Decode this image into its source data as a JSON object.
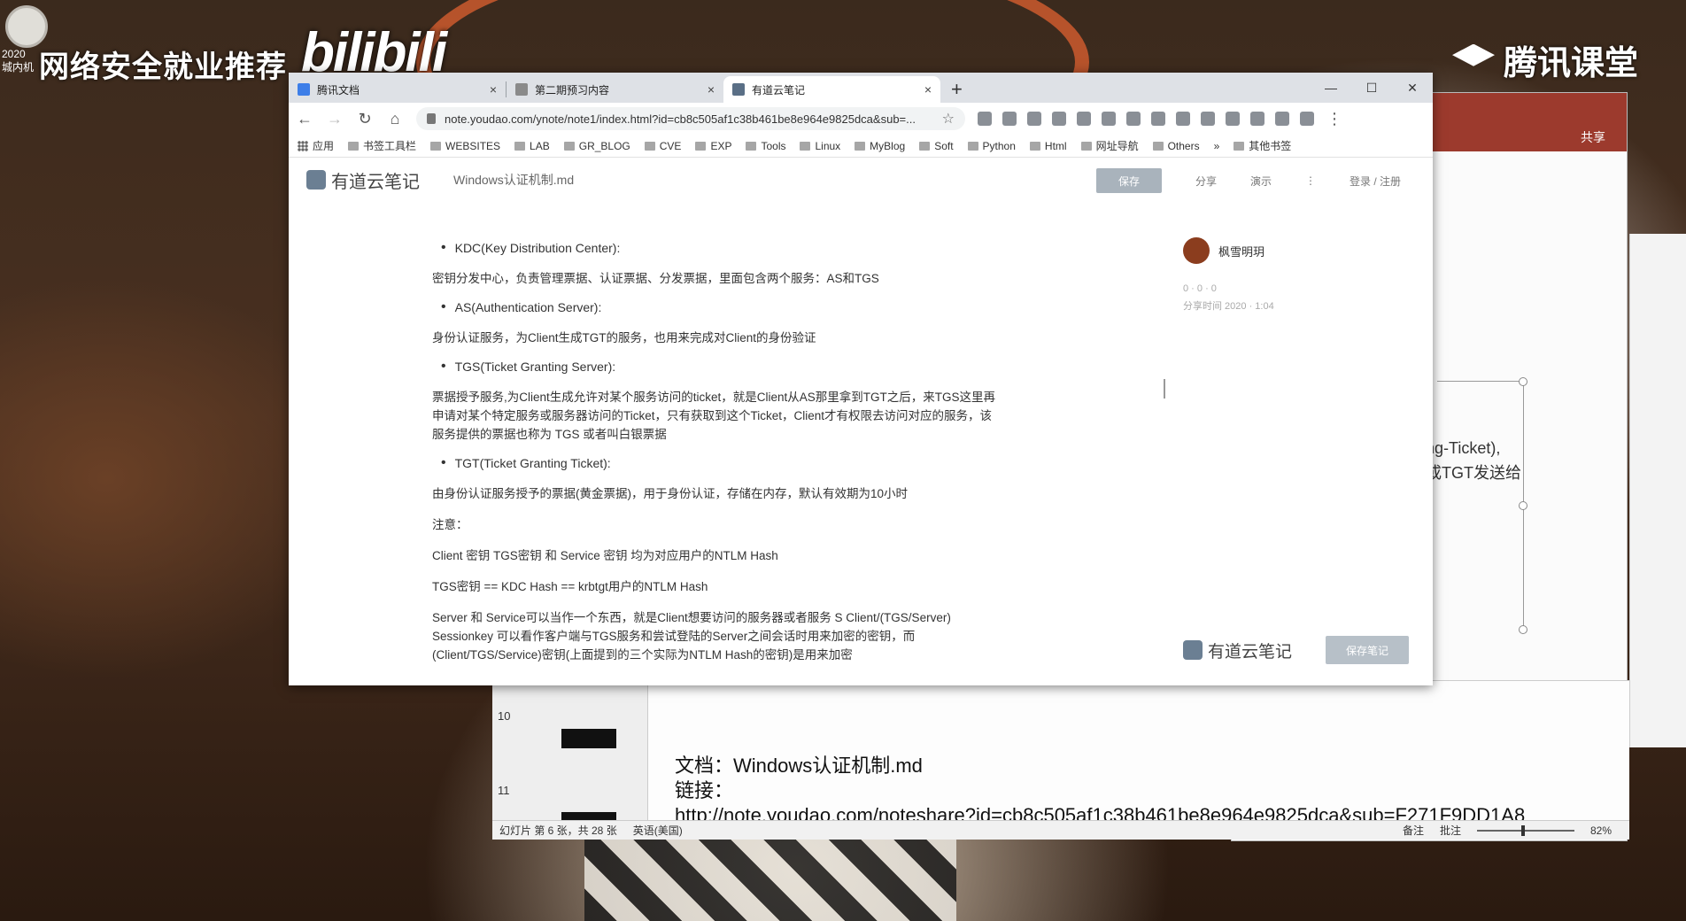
{
  "stream": {
    "title": "网络安全就业推荐",
    "date_line1": "2020",
    "date_line2": "城内机",
    "bili_logo": "bilibili",
    "tencent_logo": "腾讯课堂"
  },
  "browser": {
    "tabs": [
      {
        "label": "腾讯文档",
        "close": "×"
      },
      {
        "label": "第二期预习内容",
        "close": "×"
      },
      {
        "label": "有道云笔记",
        "close": "×"
      }
    ],
    "new_tab": "+",
    "window_controls": {
      "minimize": "—",
      "maximize": "☐",
      "close": "✕"
    },
    "url": "note.youdao.com/ynote/note1/index.html?id=cb8c505af1c38b461be8e964e9825dca&sub=...",
    "bookmarks": [
      "应用",
      "书签工具栏",
      "WEBSITES",
      "LAB",
      "GR_BLOG",
      "CVE",
      "EXP",
      "Tools",
      "Linux",
      "MyBlog",
      "Soft",
      "Python",
      "Html",
      "网址导航",
      "Others",
      "»",
      "其他书签"
    ]
  },
  "youdao": {
    "logo_text": "有道云笔记",
    "filename": "Windows认证机制.md",
    "actions": {
      "save": "保存",
      "share": "分享",
      "present": "演示",
      "more": "⋮",
      "login": "登录 / 注册"
    },
    "author": {
      "name": "枫雪明玥",
      "stats": "0 · 0 · 0",
      "time": "分享时间 2020 · 1:04"
    },
    "footer": {
      "logo_text": "有道云笔记",
      "button": "保存笔记"
    }
  },
  "article": {
    "b1": "KDC(Key Distribution Center):",
    "p1": "密钥分发中心，负责管理票据、认证票据、分发票据，里面包含两个服务：AS和TGS",
    "b2": "AS(Authentication Server):",
    "p2": "身份认证服务，为Client生成TGT的服务，也用来完成对Client的身份验证",
    "b3": "TGS(Ticket Granting Server):",
    "p3": "票据授予服务,为Client生成允许对某个服务访问的ticket，就是Client从AS那里拿到TGT之后，来TGS这里再申请对某个特定服务或服务器访问的Ticket，只有获取到这个Ticket，Client才有权限去访问对应的服务，该服务提供的票据也称为 TGS 或者叫白银票据",
    "b4": "TGT(Ticket Granting Ticket):",
    "p4": "由身份认证服务授予的票据(黄金票据)，用于身份认证，存储在内存，默认有效期为10小时",
    "p5": "注意：",
    "p6": "Client 密钥 TGS密钥 和 Service 密钥 均为对应用户的NTLM Hash",
    "p7": "TGS密钥 == KDC Hash == krbtgt用户的NTLM Hash",
    "p8": "Server 和 Service可以当作一个东西，就是Client想要访问的服务器或者服务 S Client/(TGS/Server) Sessionkey 可以看作客户端与TGS服务和尝试登陆的Server之间会话时用来加密的密钥，而(Client/TGS/Service)密钥(上面提到的三个实际为NTLM Hash的密钥)是用来加密"
  },
  "ppt": {
    "share_label": "共享",
    "slide_text_1": "ng-Ticket),",
    "slide_text_2": "或TGT发送给",
    "thumb_10": "10",
    "thumb_11": "11",
    "doc_line": "文档：Windows认证机制.md",
    "link_label": "链接：",
    "link_url": "http://note.youdao.com/noteshare?id=cb8c505af1c38b461be8e964e9825dca&sub=F271F9DD1A8",
    "status_slide": "幻灯片 第 6 张，共 28 张",
    "status_lang": "英语(美国)",
    "status_notes": "备注",
    "status_comments": "批注",
    "status_zoom": "82%"
  }
}
